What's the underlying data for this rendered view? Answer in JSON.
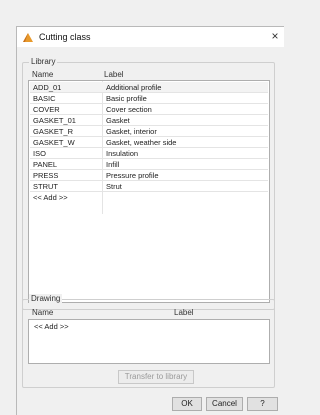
{
  "dialog": {
    "title": "Cutting class",
    "app_icon": "ruler-triangle-icon",
    "close_glyph": "×"
  },
  "library": {
    "group_title": "Library",
    "col_name": "Name",
    "col_label": "Label",
    "rows": [
      {
        "name": "ADD_01",
        "label": "Additional profile"
      },
      {
        "name": "BASIC",
        "label": "Basic profile"
      },
      {
        "name": "COVER",
        "label": "Cover section"
      },
      {
        "name": "GASKET_01",
        "label": "Gasket"
      },
      {
        "name": "GASKET_R",
        "label": "Gasket, interior"
      },
      {
        "name": "GASKET_W",
        "label": "Gasket, weather side"
      },
      {
        "name": "ISO",
        "label": "Insulation"
      },
      {
        "name": "PANEL",
        "label": "Infill"
      },
      {
        "name": "PRESS",
        "label": "Pressure profile"
      },
      {
        "name": "STRUT",
        "label": "Strut"
      }
    ],
    "add_row": "<< Add >>"
  },
  "drawing": {
    "group_title": "Drawing",
    "col_name": "Name",
    "col_label": "Label",
    "add_row": "<< Add >>",
    "transfer_button": "Transfer to library"
  },
  "footer": {
    "ok": "OK",
    "cancel": "Cancel",
    "help": "?"
  }
}
